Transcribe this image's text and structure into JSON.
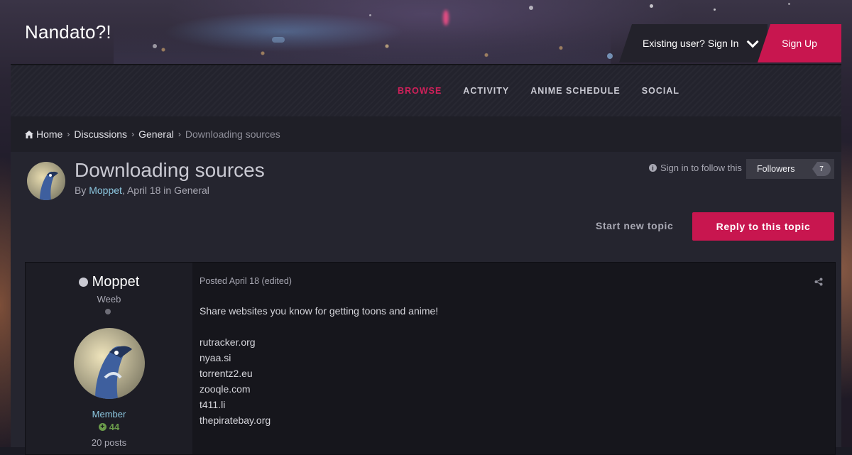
{
  "site": {
    "title": "Nandato?!"
  },
  "user_bar": {
    "signin_label": "Existing user? Sign In",
    "signup_label": "Sign Up"
  },
  "nav": {
    "items": [
      {
        "label": "BROWSE",
        "active": true
      },
      {
        "label": "ACTIVITY",
        "active": false
      },
      {
        "label": "ANIME SCHEDULE",
        "active": false
      },
      {
        "label": "SOCIAL",
        "active": false
      }
    ]
  },
  "breadcrumb": {
    "items": [
      "Home",
      "Discussions",
      "General",
      "Downloading sources"
    ]
  },
  "topic": {
    "title": "Downloading sources",
    "by_prefix": "By ",
    "author": "Moppet",
    "meta_suffix": ", April 18 in General",
    "follow_text": "Sign in to follow this",
    "followers_label": "Followers",
    "followers_count": "7",
    "start_new_label": "Start new topic",
    "reply_label": "Reply to this topic"
  },
  "post": {
    "author_name": "Moppet",
    "author_rank": "Weeb",
    "author_group": "Member",
    "reputation": "44",
    "post_count": "20 posts",
    "date": "Posted April 18 (edited)",
    "intro": "Share websites you know for getting toons and anime!",
    "links": [
      "rutracker.org",
      "nyaa.si",
      "torrentz2.eu",
      "zooqle.com",
      "t411.li",
      "thepiratebay.org"
    ]
  },
  "colors": {
    "accent": "#c8164f",
    "link": "#8cc7e0",
    "reputation": "#6a9a4a"
  }
}
